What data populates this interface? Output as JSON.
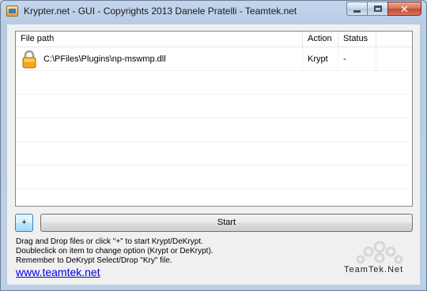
{
  "window": {
    "title": "Krypter.net - GUI - Copyrights 2013 Danele Pratelli - Teamtek.net"
  },
  "table": {
    "columns": [
      "File path",
      "Action",
      "Status"
    ],
    "rows": [
      {
        "icon": "lock-icon",
        "path": "C:\\PFiles\\Plugins\\np-mswmp.dll",
        "action": "Krypt",
        "status": "-"
      }
    ]
  },
  "buttons": {
    "add_label": "+",
    "start_label": "Start"
  },
  "help": {
    "line1": "Drag and Drop files or click \"+\" to start Krypt/DeKrypt.",
    "line2": "Doubleclick on item to change option (Krypt or DeKrypt).",
    "line3": "Remember to DeKrypt Select/Drop \"Kry\" file."
  },
  "footer": {
    "link": "www.teamtek.net",
    "logo_text": "TeamTek.Net"
  },
  "colors": {
    "link": "#0000ee",
    "titlebar": "#c4d6ec",
    "close_button": "#c44a2f"
  }
}
